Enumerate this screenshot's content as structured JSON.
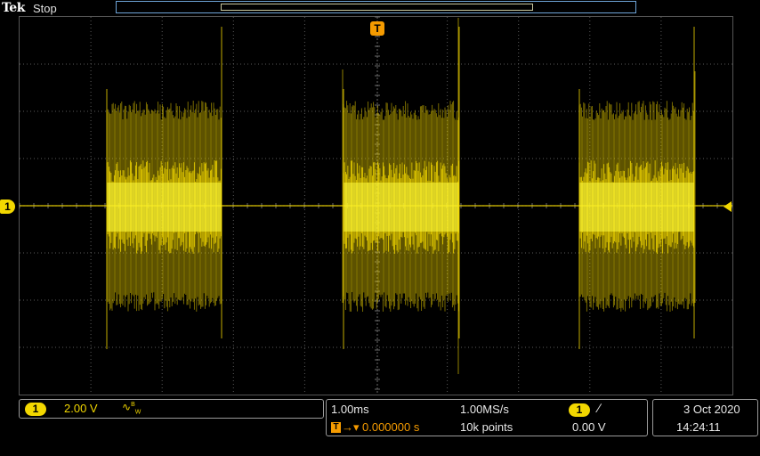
{
  "header": {
    "brand": "Tek",
    "run_state": "Stop"
  },
  "markers": {
    "channel": "1",
    "trigger": "T"
  },
  "channel_panel": {
    "channel_number": "1",
    "scale": "2.00 V",
    "coupling_icon": "ac-bandwidth-limit-icon",
    "bandwidth_label": "B W"
  },
  "timebase_panel": {
    "horizontal_scale": "1.00ms",
    "sample_rate": "1.00MS/s",
    "trigger_channel": "1",
    "trigger_slope_icon": "rising-edge-icon",
    "delay_prefix": "T",
    "delay": "0.000000 s",
    "record_length": "10k points",
    "trigger_level": "0.00 V"
  },
  "clock": {
    "date": "3 Oct  2020",
    "time": "14:24:11"
  },
  "colors": {
    "trace": "#f2d700",
    "trigger": "#f59b00",
    "record_bar": "#6ea4d8"
  }
}
